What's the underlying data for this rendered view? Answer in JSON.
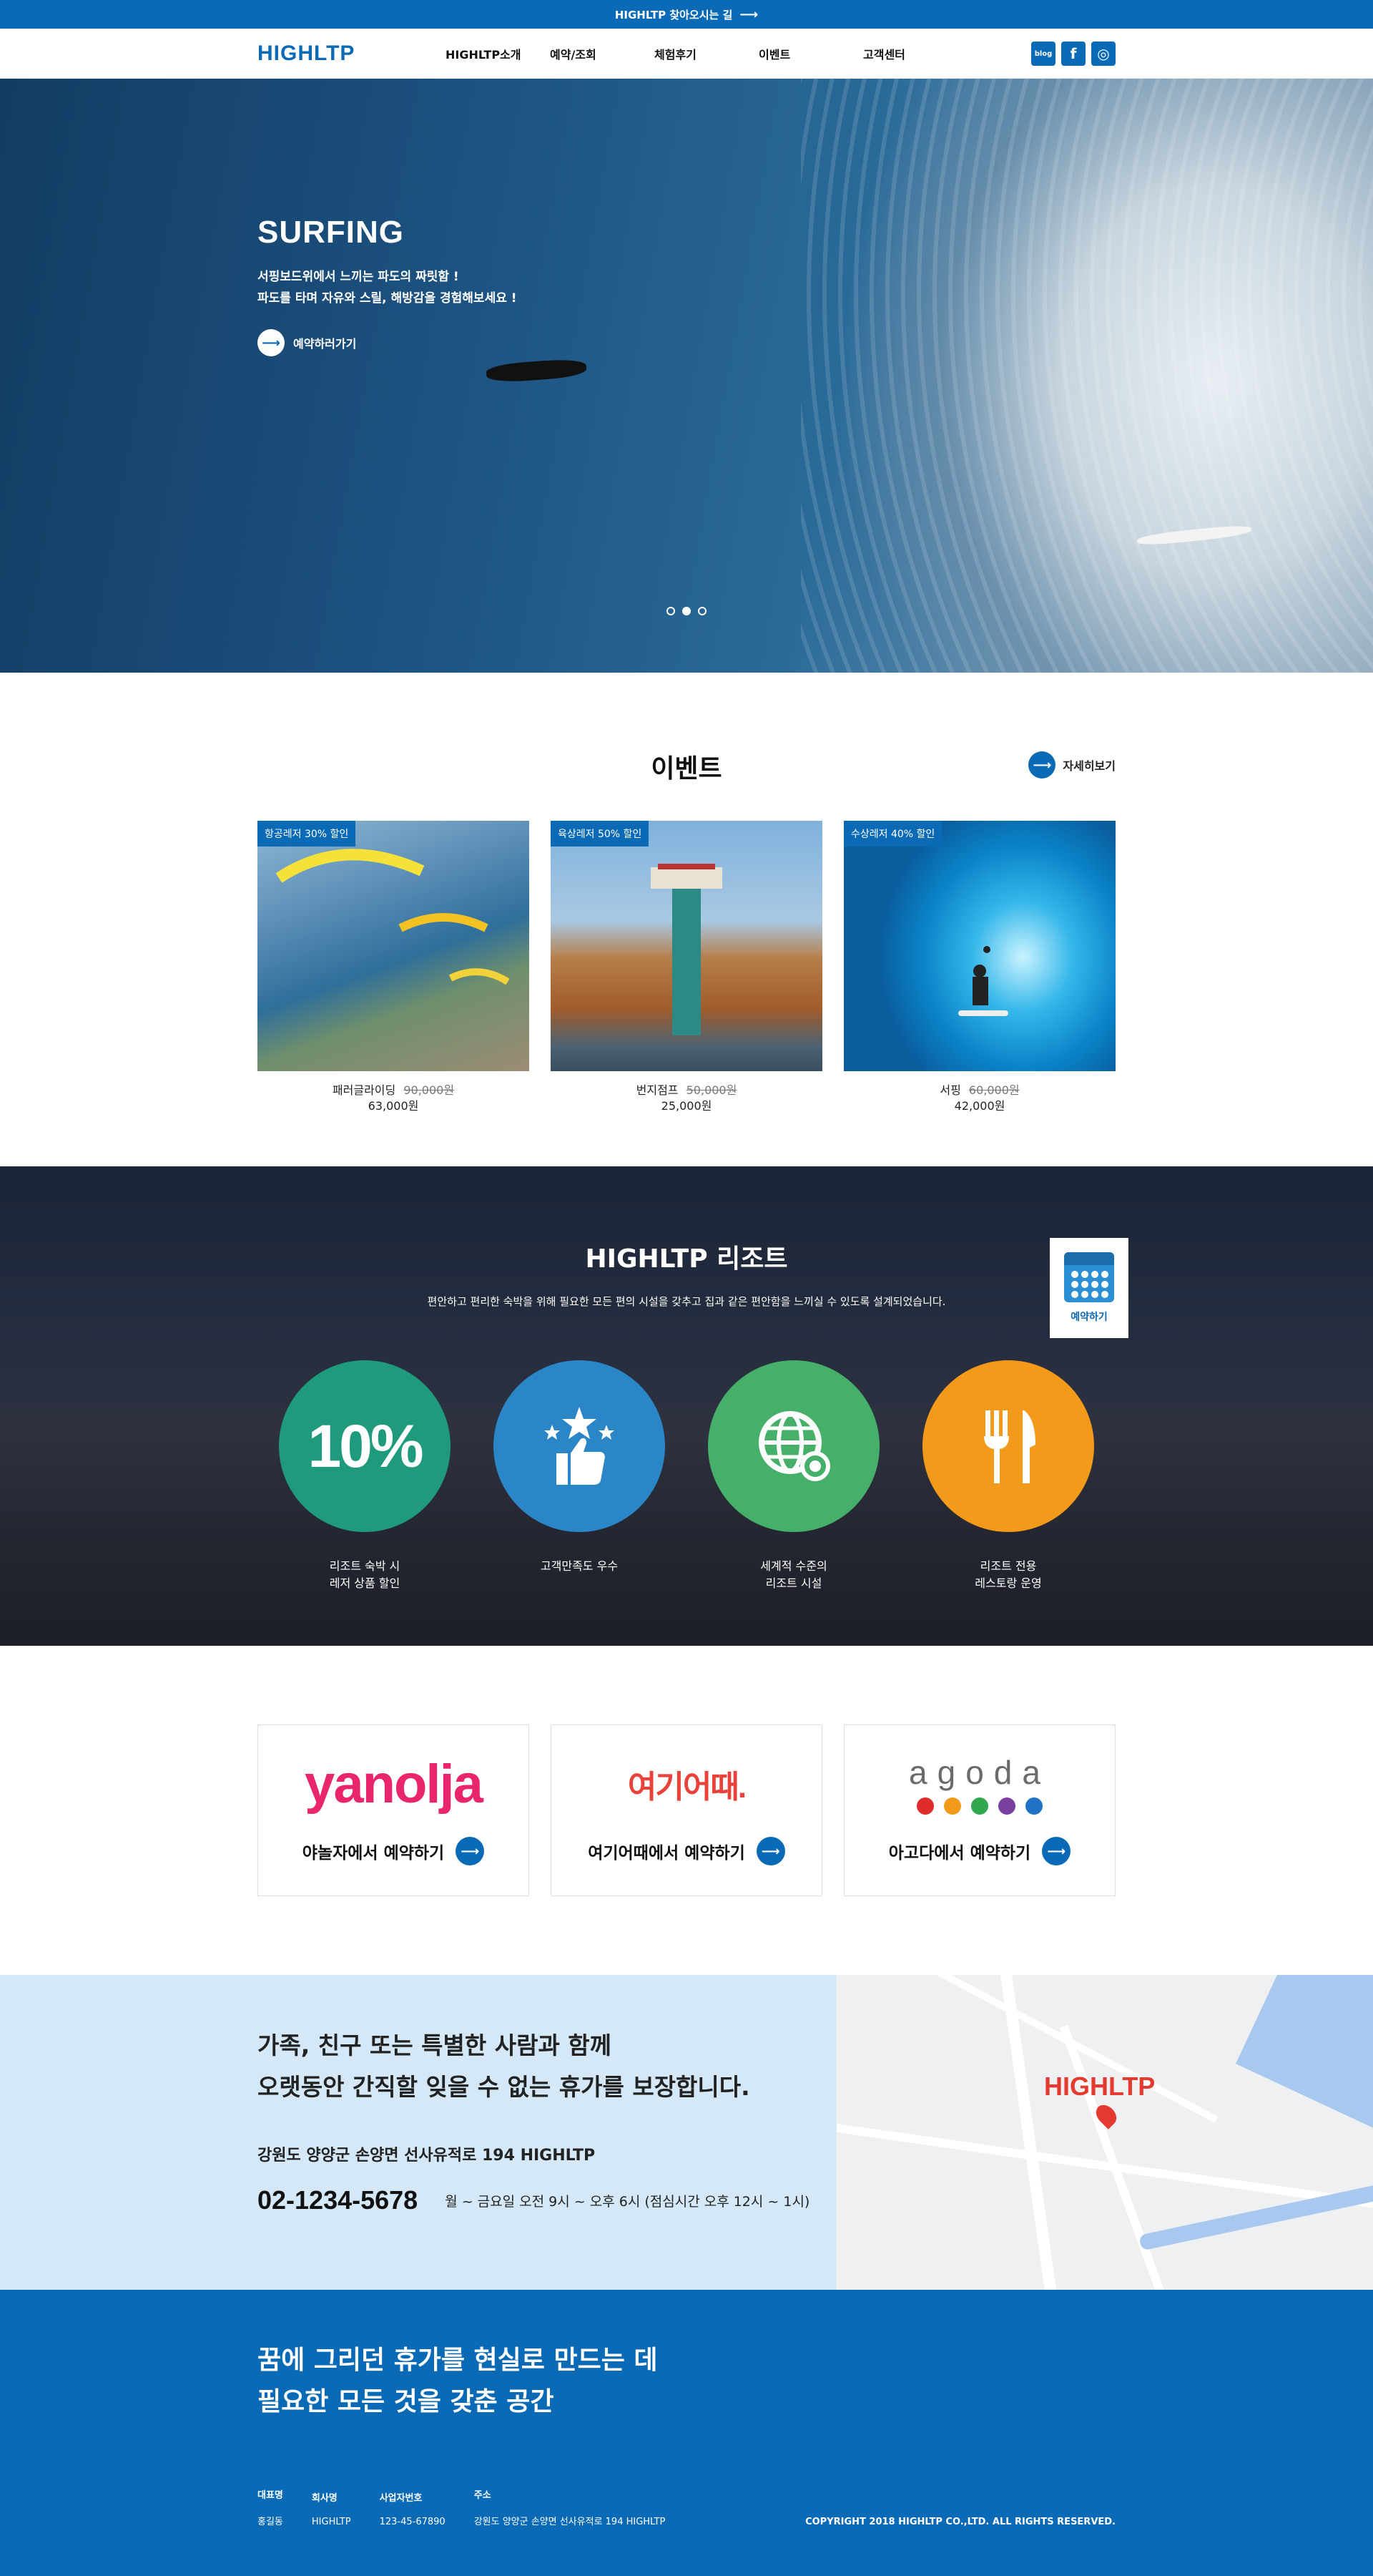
{
  "topbar": {
    "text": "HIGHLTP 찾아오시는 길",
    "arrow": "⟶"
  },
  "header": {
    "logo": "HIGHLTP",
    "nav": [
      "HIGHLTP소개",
      "예약/조회",
      "체험후기",
      "이벤트",
      "고객센터"
    ],
    "sns": [
      {
        "icon": "blog-icon",
        "label": "blog"
      },
      {
        "icon": "facebook-icon",
        "label": "f"
      },
      {
        "icon": "instagram-icon",
        "label": "◎"
      }
    ]
  },
  "hero": {
    "title": "SURFING",
    "line1": "서핑보드위에서 느끼는 파도의 짜릿함 !",
    "line2": "파도를 타며 자유와 스릴, 해방감을 경험해보세요 !",
    "cta": "예약하러가기",
    "slides": 3,
    "active_slide": 2
  },
  "events": {
    "title": "이벤트",
    "more": "자세히보기",
    "items": [
      {
        "badge": "항공레저 30% 할인",
        "name": "패러글라이딩",
        "old_price": "90,000원",
        "price": "63,000원"
      },
      {
        "badge": "육상레저 50% 할인",
        "name": "번지점프",
        "old_price": "50,000원",
        "price": "25,000원"
      },
      {
        "badge": "수상레저 40% 할인",
        "name": "서핑",
        "old_price": "60,000원",
        "price": "42,000원"
      }
    ]
  },
  "resort": {
    "title": "HIGHLTP 리조트",
    "desc": "편안하고 편리한 숙박을 위해 필요한 모든 편의 시설을 갖추고 집과 같은 편안함을 느끼실 수 있도록 설계되었습니다.",
    "reserve": "예약하기",
    "features": [
      {
        "icon": "percent-icon",
        "big": "10%",
        "l1": "리조트 숙박 시",
        "l2": "레저 상품 할인",
        "color": "#1f9a7c"
      },
      {
        "icon": "thumbs-up-stars-icon",
        "l1": "고객만족도 우수",
        "l2": "",
        "color": "#2b86c8"
      },
      {
        "icon": "globe-award-icon",
        "l1": "세계적 수준의",
        "l2": "리조트 시설",
        "color": "#46b06a"
      },
      {
        "icon": "fork-knife-icon",
        "l1": "리조트 전용",
        "l2": "레스토랑 운영",
        "color": "#f39a1b"
      }
    ]
  },
  "partners": [
    {
      "logo": "yanolja",
      "action": "야놀자에서 예약하기"
    },
    {
      "logo": "여기어때.",
      "action": "여기어때에서 예약하기"
    },
    {
      "logo": "agoda",
      "action": "아고다에서 예약하기",
      "dot_colors": [
        "#e02b2b",
        "#f39a1b",
        "#2fa84f",
        "#7a3fa0",
        "#1f72c4"
      ]
    }
  ],
  "contact": {
    "line1": "가족, 친구 또는 특별한 사람과 함께",
    "line2": "오랫동안 간직할 잊을 수 없는 휴가를 보장합니다.",
    "address": "강원도 양양군 손양면 선사유적로 194 HIGHLTP",
    "phone": "02-1234-5678",
    "hours": "월 ~ 금요일 오전 9시 ~ 오후 6시 (점심시간 오후 12시 ~ 1시)",
    "map_label": "HIGHLTP"
  },
  "footer": {
    "line1": "꿈에 그리던 휴가를 현실로 만드는 데",
    "line2": "필요한 모든 것을 갖춘 공간",
    "cols": [
      {
        "k": "대표명",
        "v": "홍길동"
      },
      {
        "k": "회사명",
        "v": "HIGHLTP"
      },
      {
        "k": "사업자번호",
        "v": "123-45-67890"
      },
      {
        "k": "주소",
        "v": "강원도 양양군 손양면 선사유적로 194 HIGHLTP"
      }
    ],
    "copyright": "COPYRIGHT 2018 HIGHLTP CO.,LTD. ALL RIGHTS RESERVED."
  }
}
